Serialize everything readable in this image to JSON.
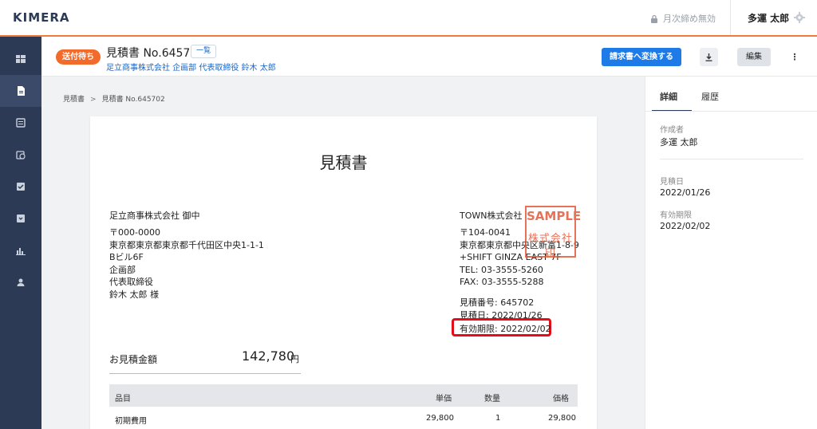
{
  "topbar": {
    "logo": "KIMERA",
    "lock_text": "月次締め無効",
    "user_name": "多運 太郎"
  },
  "header": {
    "status_badge": "送付待ち",
    "title": "見積書 No.645702",
    "list_link": "一覧",
    "company": "足立商事株式会社 企画部 代表取締役 鈴木 太郎",
    "convert_label": "請求書へ変換する",
    "edit_label": "編集",
    "more_label": "⋮"
  },
  "breadcrumb": {
    "root": "見積書",
    "separator": ">",
    "current": "見積書 No.645702"
  },
  "paper": {
    "title": "見積書",
    "customer_name": "足立商事株式会社 御中",
    "customer_lines": [
      "〒000-0000",
      "東京都東京都東京都千代田区中央1-1-1",
      "Bビル6F",
      "企画部",
      "代表取締役",
      "鈴木 太郎 様"
    ],
    "seller_name": "TOWN株式会社",
    "seller_lines": [
      "〒104-0041",
      "東京都東京都中央区新富1-8-9",
      "+SHIFT GINZA EAST 7F",
      "TEL: 03-3555-5260",
      "FAX: 03-3555-5288"
    ],
    "stamp_text": "SAMPLE",
    "stamp_sub": "株式会社印",
    "estimate_number": "見積番号: 645702",
    "estimate_date": "見積日: 2022/01/26",
    "expiry": "有効期限: 2022/02/02",
    "total_label": "お見積金額",
    "total_value": "142,780",
    "total_unit": "円",
    "table": {
      "headers": [
        "品目",
        "単価",
        "数量",
        "価格"
      ],
      "rows": [
        [
          "初期費用",
          "29,800",
          "1",
          "29,800"
        ]
      ]
    }
  },
  "panel": {
    "tabs": [
      "詳細",
      "履歴"
    ],
    "creator_label": "作成者",
    "creator_value": "多運 太郎",
    "date_label": "見積日",
    "date_value": "2022/01/26",
    "expiry_label": "有効期限",
    "expiry_value": "2022/02/02"
  },
  "colors": {
    "accent": "#f07a3a",
    "primary": "#1e7ae6",
    "sidebar": "#2d3a55",
    "highlight": "#e40e1b"
  }
}
